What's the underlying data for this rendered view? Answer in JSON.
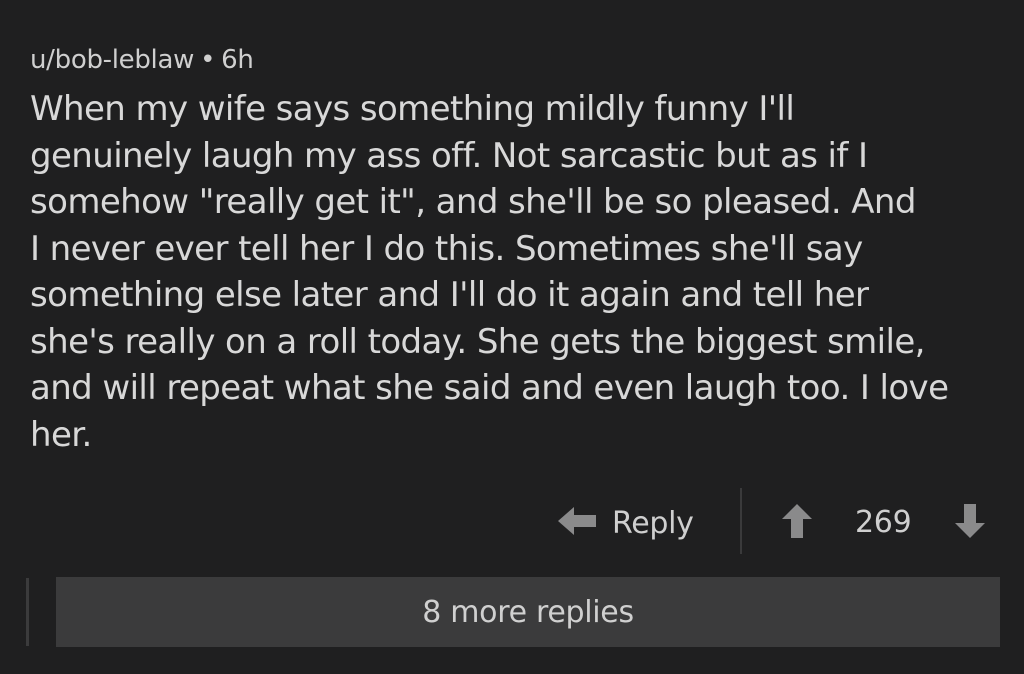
{
  "comment": {
    "username": "u/bob-leblaw",
    "separator": "•",
    "age": "6h",
    "text": "When my wife says something mildly funny I'll\ngenuinely laugh my ass off. Not sarcastic but as if I\nsomehow \"really get it\", and she'll be so pleased. And\nI never ever tell her I do this. Sometimes she'll say\nsomething else later and I'll do it again and tell her\nshe's really on a roll today. She gets the biggest smile,\nand will repeat what she said and even laugh too. I love\nher."
  },
  "actions": {
    "reply_label": "Reply",
    "reply_icon": "reply-arrow-icon",
    "upvote_icon": "upvote-arrow-icon",
    "score": "269",
    "downvote_icon": "downvote-arrow-icon"
  },
  "thread": {
    "more_replies_label": "8 more replies"
  },
  "colors": {
    "background": "#1f1f20",
    "text": "#d8d8d8",
    "icon": "#8a8a8b",
    "more_replies_bg": "#3b3b3c"
  }
}
